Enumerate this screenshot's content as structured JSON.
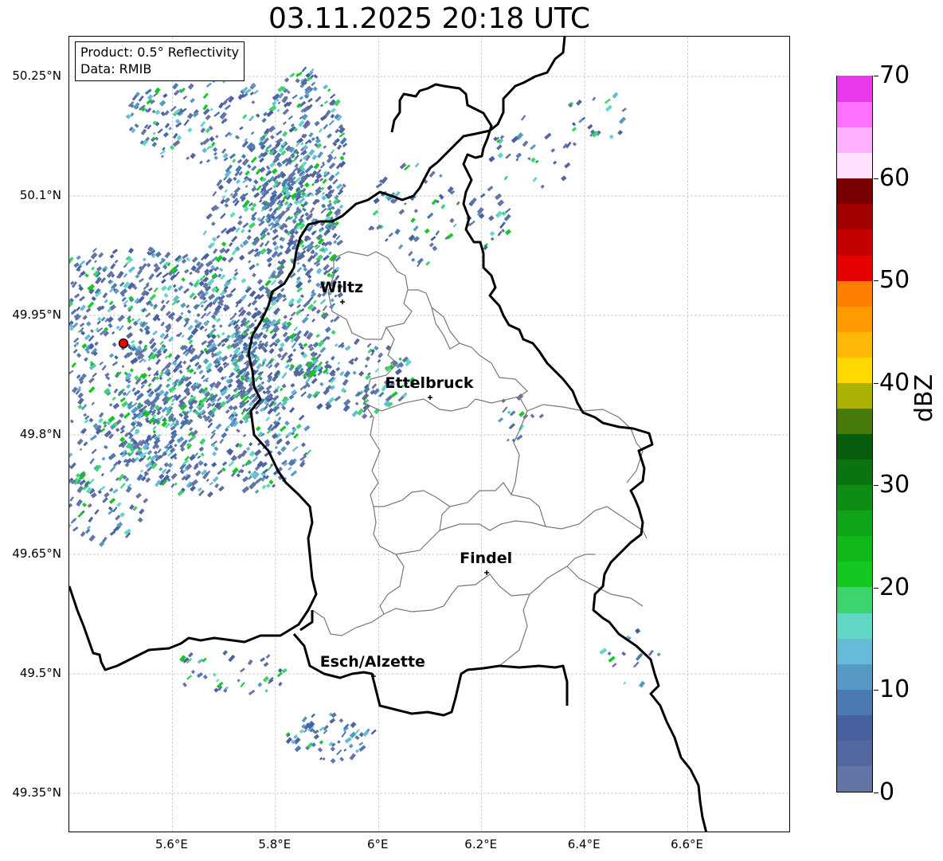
{
  "title": "03.11.2025 20:18 UTC",
  "info_box": {
    "product": "Product: 0.5° Reflectivity",
    "data_source": "Data: RMIB"
  },
  "lat_labels": [
    "50.25°N",
    "50.1°N",
    "49.95°N",
    "49.8°N",
    "49.65°N",
    "49.5°N",
    "49.35°N"
  ],
  "lat_values": [
    50.25,
    50.1,
    49.95,
    49.8,
    49.65,
    49.5,
    49.35
  ],
  "lon_labels": [
    "5.6°E",
    "5.8°E",
    "6°E",
    "6.2°E",
    "6.4°E",
    "6.6°E"
  ],
  "lon_values": [
    5.6,
    5.8,
    6.0,
    6.2,
    6.4,
    6.6
  ],
  "map_extent": {
    "lon_min": 5.4,
    "lon_max": 6.8,
    "lat_min": 49.3,
    "lat_max": 50.3
  },
  "cities": [
    {
      "name": "Wiltz",
      "lon": 5.93,
      "lat": 49.967
    },
    {
      "name": "Ettelbruck",
      "lon": 6.1,
      "lat": 49.847
    },
    {
      "name": "Findel",
      "lon": 6.21,
      "lat": 49.627
    },
    {
      "name": "Esch/Alzette",
      "lon": 5.99,
      "lat": 49.497
    }
  ],
  "radar_site": {
    "lon": 5.505,
    "lat": 49.915
  },
  "colorbar": {
    "unit": "dBZ",
    "min": 0,
    "max": 70,
    "tick_labels": [
      "0",
      "10",
      "20",
      "30",
      "40",
      "50",
      "60",
      "70"
    ],
    "colors": [
      "#6474a6",
      "#5467a0",
      "#4660a1",
      "#4b79b2",
      "#5599c4",
      "#66bcd8",
      "#62d7c6",
      "#3dd46e",
      "#14c822",
      "#12b81a",
      "#10a418",
      "#0e8d14",
      "#0a7510",
      "#085d0c",
      "#477a0a",
      "#aab204",
      "#ffd800",
      "#ffb808",
      "#ff9a00",
      "#ff7e00",
      "#e60000",
      "#c40000",
      "#a00000",
      "#780000",
      "#ffe0ff",
      "#ffb0ff",
      "#ff72ff",
      "#ea38ea"
    ]
  }
}
